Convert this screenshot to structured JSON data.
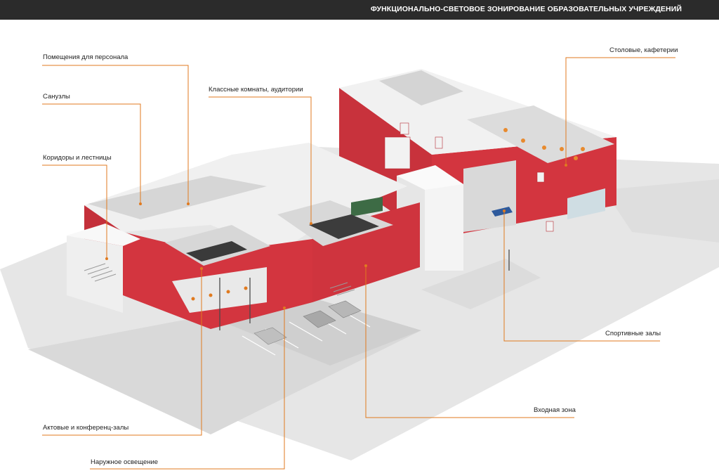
{
  "header": {
    "title": "ФУНКЦИОНАЛЬНО-СВЕТОВОЕ ЗОНИРОВАНИЕ ОБРАЗОВАТЕЛЬНЫХ УЧРЕЖДЕНИЙ"
  },
  "colors": {
    "header_bg": "#2b2b2b",
    "accent": "#e07a1f",
    "wall_red": "#d0353f",
    "wall_white": "#eeeeee",
    "ground": "#e2e2e2"
  },
  "labels": {
    "staff": "Помещения для персонала",
    "toilets": "Санузлы",
    "corridors": "Коридоры и лестницы",
    "classrooms": "Классные комнаты, аудитории",
    "canteen": "Столовые, кафетерии",
    "sports": "Спортивные залы",
    "entrance": "Входная зона",
    "halls": "Актовые и конференц-залы",
    "outdoor": "Наружное освещение"
  }
}
